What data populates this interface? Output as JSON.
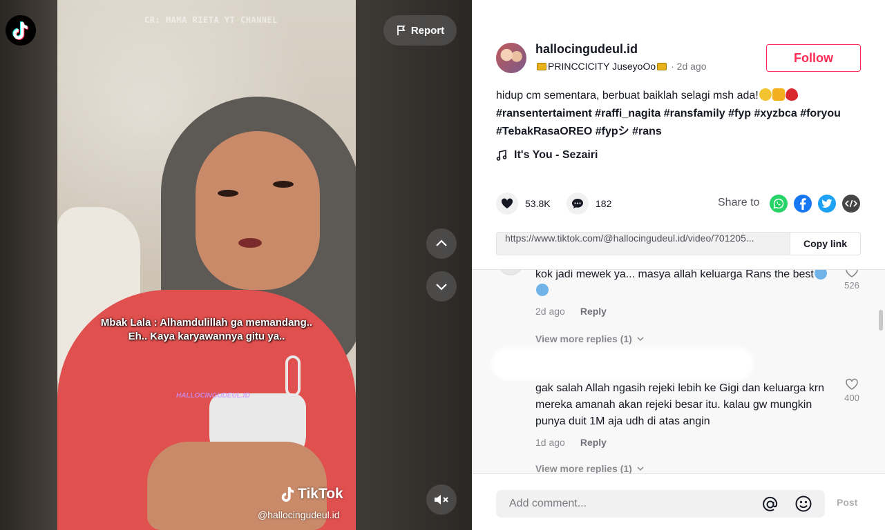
{
  "viewer": {
    "report_label": "Report",
    "credit_text": "CR: MAMA RIETA YT CHANNEL",
    "caption_line1": "Mbak Lala : Alhamdulillah ga memandang..",
    "caption_line2": "Eh.. Kaya karyawannya gitu ya..",
    "watermark": "HALLOCINGUDEUL.ID",
    "brand": "TikTok",
    "handle": "@hallocingudeul.id",
    "icons": {
      "logo": "tiktok-logo",
      "report": "flag-icon",
      "prev": "chevron-up-icon",
      "next": "chevron-down-icon",
      "mute": "speaker-muted-icon"
    }
  },
  "author": {
    "username": "hallocingudeul.id",
    "nickname": "PRINCCICITY JuseyoOo",
    "posted": "· 2d ago",
    "follow_label": "Follow"
  },
  "post": {
    "caption": "hidup cm sementara, berbuat baiklah selagi msh ada!",
    "hashtags_line1": "#ransentertaiment #raffi_nagita #ransfamily #fyp #xyzbca #foryou",
    "hashtags_line2": "#TebakRasaOREO #fypシ #rans",
    "music": "It's You - Sezairi"
  },
  "actions": {
    "likes": "53.8K",
    "comments": "182",
    "share_label": "Share to",
    "share_targets": [
      "whatsapp-icon",
      "facebook-icon",
      "twitter-icon",
      "embed-icon"
    ]
  },
  "link": {
    "url": "https://www.tiktok.com/@hallocingudeul.id/video/701205...",
    "copy_label": "Copy link"
  },
  "comments": [
    {
      "text": "kok jadi mewek ya... masya allah keluarga Rans the best",
      "age": "2d ago",
      "reply_label": "Reply",
      "likes": "526",
      "more_replies": "View more replies (1)"
    },
    {
      "text": "gak salah Allah ngasih rejeki lebih ke Gigi dan keluarga krn mereka amanah akan rejeki besar itu. kalau gw mungkin punya duit 1M aja udh di atas angin",
      "age": "1d ago",
      "reply_label": "Reply",
      "likes": "400",
      "more_replies": "View more replies (1)"
    }
  ],
  "add_comment": {
    "placeholder": "Add comment...",
    "post_label": "Post"
  },
  "colors": {
    "accent": "#fe2c55",
    "text": "#161823",
    "whatsapp": "#25d366",
    "facebook": "#1877f2",
    "twitter": "#1da1f2",
    "embed": "#454545"
  }
}
